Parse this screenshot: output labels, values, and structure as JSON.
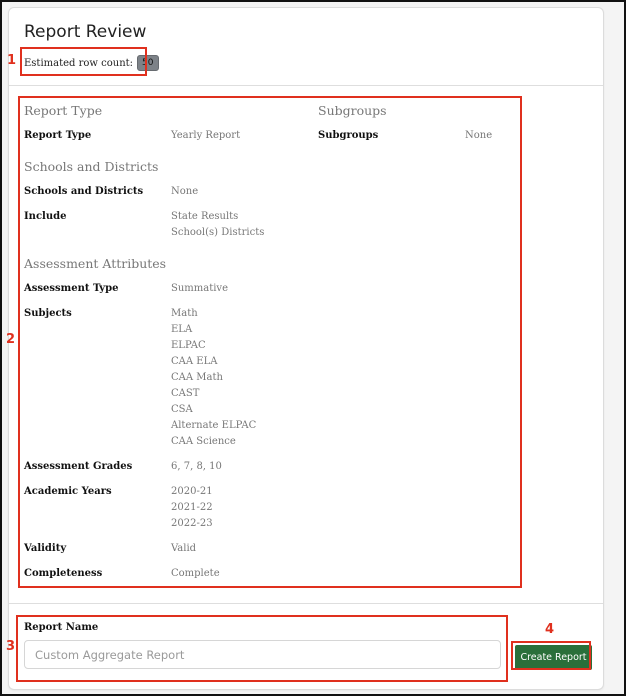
{
  "header": {
    "title": "Report Review",
    "row_count_label": "Estimated row count:",
    "row_count_value": "50"
  },
  "left_sections": [
    {
      "heading": "Report Type",
      "fields": [
        {
          "label": "Report Type",
          "values": [
            "Yearly Report"
          ]
        }
      ]
    },
    {
      "heading": "Schools and Districts",
      "fields": [
        {
          "label": "Schools and Districts",
          "values": [
            "None"
          ]
        },
        {
          "label": "Include",
          "values": [
            "State Results",
            "School(s) Districts"
          ]
        }
      ]
    },
    {
      "heading": "Assessment Attributes",
      "fields": [
        {
          "label": "Assessment Type",
          "values": [
            "Summative"
          ]
        },
        {
          "label": "Subjects",
          "values": [
            "Math",
            "ELA",
            "ELPAC",
            "CAA ELA",
            "CAA Math",
            "CAST",
            "CSA",
            "Alternate ELPAC",
            "CAA Science"
          ]
        },
        {
          "label": "Assessment Grades",
          "values": [
            "6, 7, 8, 10"
          ]
        },
        {
          "label": "Academic Years",
          "values": [
            "2020-21",
            "2021-22",
            "2022-23"
          ]
        },
        {
          "label": "Validity",
          "values": [
            "Valid"
          ]
        },
        {
          "label": "Completeness",
          "values": [
            "Complete"
          ]
        }
      ]
    }
  ],
  "right_sections": [
    {
      "heading": "Subgroups",
      "fields": [
        {
          "label": "Subgroups",
          "values": [
            "None"
          ]
        }
      ]
    }
  ],
  "footer": {
    "report_name_label": "Report Name",
    "report_name_value": "",
    "report_name_placeholder": "Custom Aggregate Report",
    "create_button_label": "Create Report"
  },
  "annotations": [
    "1",
    "2",
    "3",
    "4"
  ],
  "colors": {
    "accent_button": "#2a6f3a",
    "annotation": "#e0301e",
    "badge": "#7d8288"
  }
}
